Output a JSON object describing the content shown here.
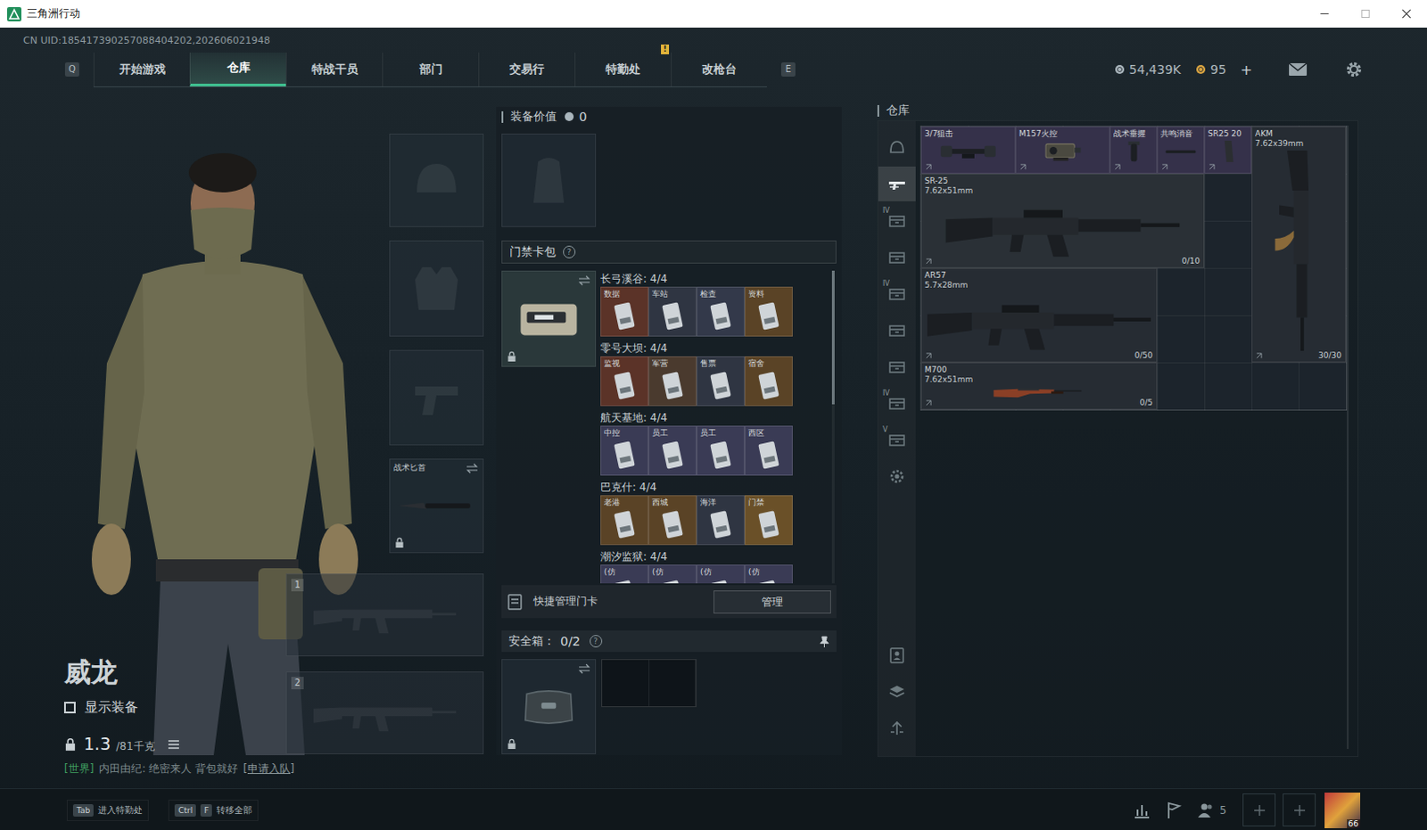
{
  "window": {
    "title": "三角洲行动"
  },
  "uid": "CN UID:185417390257088404202,202606021948",
  "nav": {
    "prev_key": "Q",
    "next_key": "E",
    "tabs": [
      {
        "label": "开始游戏",
        "selected": false,
        "badge": ""
      },
      {
        "label": "仓库",
        "selected": true,
        "badge": ""
      },
      {
        "label": "特战干员",
        "selected": false,
        "badge": ""
      },
      {
        "label": "部门",
        "selected": false,
        "badge": ""
      },
      {
        "label": "交易行",
        "selected": false,
        "badge": ""
      },
      {
        "label": "特勤处",
        "selected": false,
        "badge": "!"
      },
      {
        "label": "改枪台",
        "selected": false,
        "badge": ""
      }
    ]
  },
  "currency": [
    {
      "value": "54,439K",
      "color": "#aab6bd"
    },
    {
      "value": "95",
      "color": "#d9a441"
    }
  ],
  "add_currency": "+",
  "character": {
    "name": "威龙",
    "show_equipment": {
      "label": "显示装备",
      "checked": false
    },
    "weight": "1.3",
    "weight_max": "/81千克"
  },
  "loadout": {
    "knife_label": "战术匕首",
    "weapon_slots": [
      "1",
      "2"
    ]
  },
  "chat": {
    "channel": "[世界]",
    "message": "内田由纪: 绝密来人 背包就好",
    "action": "[申请入队]"
  },
  "equipment": {
    "value_label": "装备价值",
    "value": "0",
    "keycard_title": "门禁卡包",
    "help": "?",
    "groups": [
      {
        "title": "长弓溪谷: 4/4",
        "cards": [
          {
            "label": "数据",
            "color": "#5b3328"
          },
          {
            "label": "车站",
            "color": "#2f3542"
          },
          {
            "label": "检查",
            "color": "#33394a"
          },
          {
            "label": "资料",
            "color": "#5a4326"
          }
        ]
      },
      {
        "title": "零号大坝: 4/4",
        "cards": [
          {
            "label": "监视",
            "color": "#5b3328"
          },
          {
            "label": "军营",
            "color": "#4a3a2e"
          },
          {
            "label": "售票",
            "color": "#2f3542"
          },
          {
            "label": "宿舍",
            "color": "#5a4326"
          }
        ]
      },
      {
        "title": "航天基地: 4/4",
        "cards": [
          {
            "label": "中控",
            "color": "#3a3b55"
          },
          {
            "label": "员工",
            "color": "#3a3b55"
          },
          {
            "label": "员工",
            "color": "#3a3b55"
          },
          {
            "label": "西区",
            "color": "#3a3b55"
          }
        ]
      },
      {
        "title": "巴克什: 4/4",
        "cards": [
          {
            "label": "老港",
            "color": "#5a4326"
          },
          {
            "label": "西城",
            "color": "#5a4326"
          },
          {
            "label": "海洋",
            "color": "#2f3542"
          },
          {
            "label": "门禁",
            "color": "#6a5028"
          }
        ]
      },
      {
        "title": "潮汐监狱: 4/4",
        "cards": [
          {
            "label": "(仿",
            "color": "#3a3b55"
          },
          {
            "label": "(仿",
            "color": "#3a3b55"
          },
          {
            "label": "(仿",
            "color": "#3a3b55"
          },
          {
            "label": "(仿",
            "color": "#3a3b55"
          }
        ]
      }
    ],
    "quick_manage": "快捷管理门卡",
    "manage_button": "管理",
    "safe_label": "安全箱：",
    "safe_count": "0/2"
  },
  "warehouse": {
    "title": "仓库",
    "sidebar": [
      {
        "kind": "helmet",
        "badge": "",
        "selected": false
      },
      {
        "kind": "weapon",
        "badge": "",
        "selected": true
      },
      {
        "kind": "crate",
        "badge": "IV",
        "selected": false
      },
      {
        "kind": "crate",
        "badge": "",
        "selected": false
      },
      {
        "kind": "crate",
        "badge": "IV",
        "selected": false
      },
      {
        "kind": "crate",
        "badge": "",
        "selected": false
      },
      {
        "kind": "crate",
        "badge": "",
        "selected": false
      },
      {
        "kind": "crate",
        "badge": "IV",
        "selected": false
      },
      {
        "kind": "crate",
        "badge": "V",
        "selected": false
      },
      {
        "kind": "gear",
        "badge": "",
        "selected": false
      }
    ],
    "tools": [
      {
        "kind": "operator"
      },
      {
        "kind": "layers"
      },
      {
        "kind": "sort"
      }
    ],
    "items": [
      {
        "name": "3/7狙击",
        "caliber": "",
        "ammo": "",
        "kind": "scope",
        "color": "#35314a"
      },
      {
        "name": "M157火控",
        "caliber": "",
        "ammo": "",
        "kind": "sight",
        "color": "#35314a"
      },
      {
        "name": "战术垂握",
        "caliber": "",
        "ammo": "",
        "kind": "grip",
        "color": "#35314a"
      },
      {
        "name": "共鸣消音",
        "caliber": "",
        "ammo": "",
        "kind": "suppressor",
        "color": "#35314a"
      },
      {
        "name": "SR25 20",
        "caliber": "",
        "ammo": "",
        "kind": "mag",
        "color": "#35314a"
      },
      {
        "name": "AKM",
        "caliber": "7.62x39mm",
        "ammo": "30/30",
        "kind": "rifle-vertical",
        "color": "#262c33"
      },
      {
        "name": "SR-25",
        "caliber": "7.62x51mm",
        "ammo": "0/10",
        "kind": "rifle",
        "color": "#2a3036"
      },
      {
        "name": "AR57",
        "caliber": "5.7x28mm",
        "ammo": "0/50",
        "kind": "rifle",
        "color": "#262c33"
      },
      {
        "name": "M700",
        "caliber": "7.62x51mm",
        "ammo": "0/5",
        "kind": "bolt",
        "color": "#262c33"
      }
    ]
  },
  "bottom": {
    "hints": [
      {
        "keys": [
          "Tab"
        ],
        "label": "进入特勤处"
      },
      {
        "keys": [
          "Ctrl",
          "F"
        ],
        "label": "转移全部"
      }
    ],
    "friends": "5",
    "avatar_level": "66"
  }
}
